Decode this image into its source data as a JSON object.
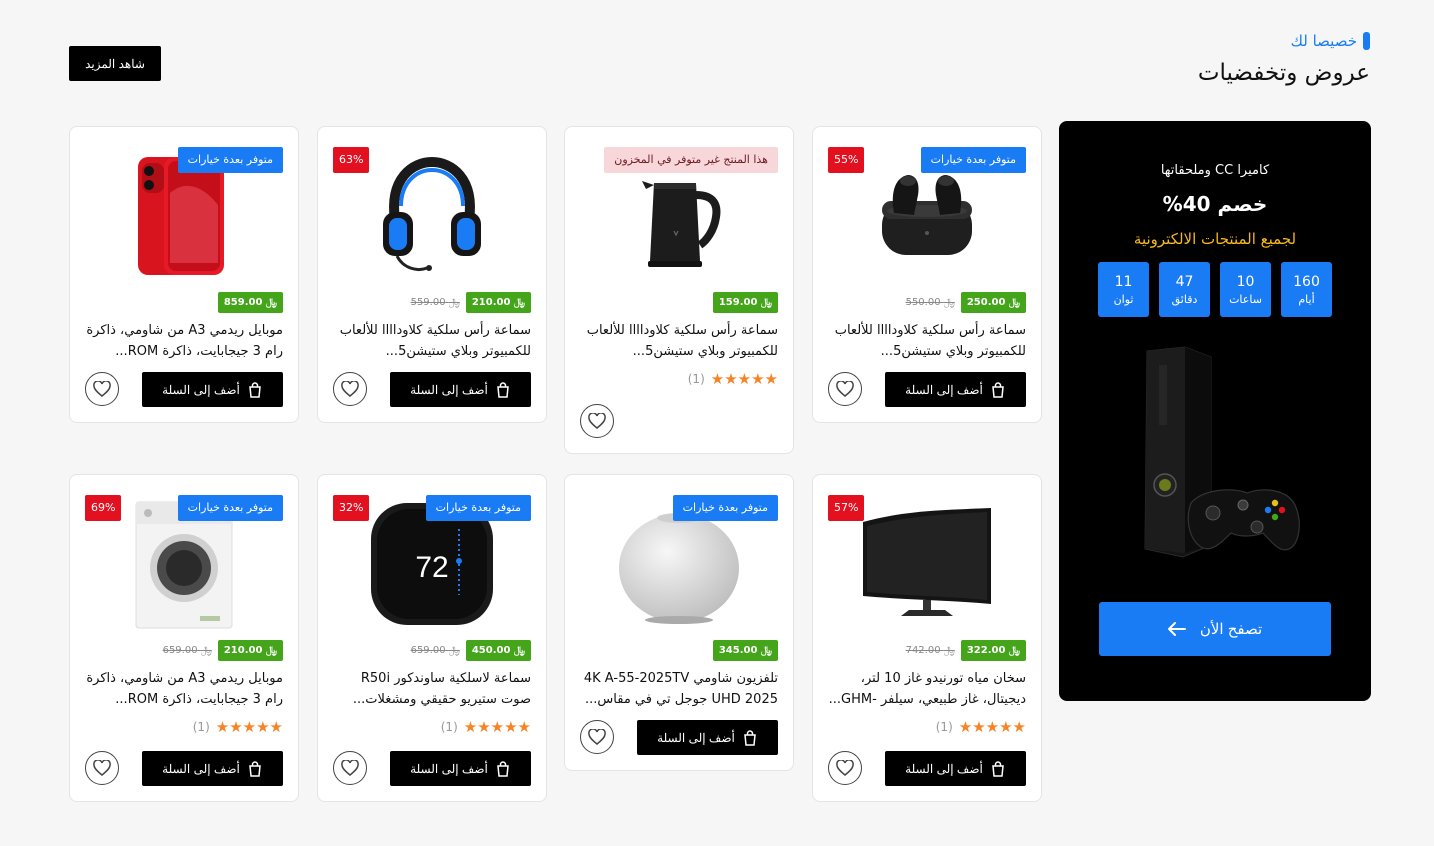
{
  "header": {
    "tag": "خصيصا لك",
    "title": "عروض وتخفضيات",
    "see_more": "شاهد المزيد"
  },
  "promo": {
    "subtitle": "كاميرا CC وملحقاتها",
    "headline": "خصم 40%",
    "accent": "لجميع المنتجات الالكترونية",
    "countdown": [
      {
        "value": "160",
        "label": "أيام"
      },
      {
        "value": "10",
        "label": "ساعات"
      },
      {
        "value": "47",
        "label": "دقائق"
      },
      {
        "value": "11",
        "label": "ثوان"
      }
    ],
    "button": "تصفح الأن",
    "image_icon": "game-console-icon"
  },
  "common": {
    "add_to_cart": "أضف إلى السلة",
    "currency": "﷼",
    "options_badge": "متوفر بعدة خيارات",
    "out_of_stock_badge": "هذا المنتج غير متوفر في المخزون"
  },
  "products": [
    {
      "name": "سماعة رأس سلكية كلاوداااا للألعاب للكمبيوتر وبلاي ستيشن5...",
      "price": "250.00",
      "old_price": "550.00",
      "discount": "55%",
      "options": true,
      "image": "earbuds-icon",
      "rating": null,
      "cart": true
    },
    {
      "name": "سماعة رأس سلكية كلاوداااا للألعاب للكمبيوتر وبلاي ستيشن5...",
      "price": "159.00",
      "old_price": null,
      "discount": null,
      "oos": true,
      "image": "kettle-icon",
      "rating": {
        "stars": "★★★★★",
        "count": "(1)"
      },
      "cart": false
    },
    {
      "name": "سماعة رأس سلكية كلاوداااا للألعاب للكمبيوتر وبلاي ستيشن5...",
      "price": "210.00",
      "old_price": "559.00",
      "discount": "63%",
      "image": "headset-icon",
      "rating": null,
      "cart": true
    },
    {
      "name": "موبايل ريدمي A3 من شاومي، ذاكرة رام 3 جيجابايت، ذاكرة ROM...",
      "price": "859.00",
      "old_price": null,
      "discount": null,
      "options": true,
      "image": "phone-icon",
      "rating": null,
      "cart": true
    },
    {
      "name": "سخان مياه تورنيدو غاز 10 لتر، ديجيتال، غاز طبيعي، سيلفر -GHM...",
      "price": "322.00",
      "old_price": "742.00",
      "discount": "57%",
      "image": "monitor-icon",
      "rating": {
        "stars": "★★★★★",
        "count": "(1)"
      },
      "cart": true
    },
    {
      "name": "تلفزيون شاومي 4K A-55-2025TV UHD 2025 جوجل تي في مقاس...",
      "price": "345.00",
      "old_price": null,
      "discount": null,
      "options": true,
      "image": "speaker-icon",
      "rating": null,
      "cart": true
    },
    {
      "name": "سماعة لاسلكية ساوندكور R50i صوت ستيريو حقيقي ومشغلات...",
      "price": "450.00",
      "old_price": "659.00",
      "discount": "32%",
      "options": true,
      "image": "thermostat-icon",
      "thermostat_reading": "72",
      "rating": {
        "stars": "★★★★★",
        "count": "(1)"
      },
      "cart": true
    },
    {
      "name": "موبايل ريدمي A3 من شاومي، ذاكرة رام 3 جيجابايت، ذاكرة ROM...",
      "price": "210.00",
      "old_price": "659.00",
      "discount": "69%",
      "options": true,
      "image": "washing-machine-icon",
      "rating": {
        "stars": "★★★★★",
        "count": "(1)"
      },
      "cart": true
    }
  ]
}
